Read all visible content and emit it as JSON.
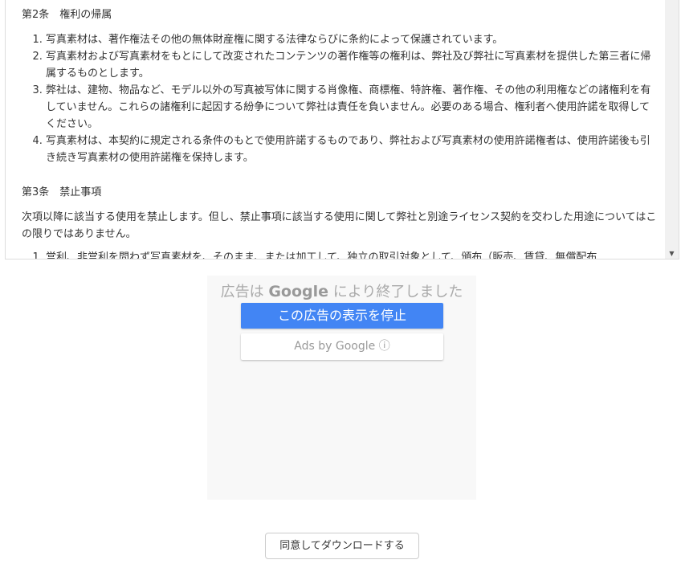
{
  "terms": {
    "article2": {
      "heading": "第2条　権利の帰属",
      "items": [
        "写真素材は、著作権法その他の無体財産権に関する法律ならびに条約によって保護されています。",
        "写真素材および写真素材をもとにして改変されたコンテンツの著作権等の権利は、弊社及び弊社に写真素材を提供した第三者に帰属するものとします。",
        "弊社は、建物、物品など、モデル以外の写真被写体に関する肖像権、商標権、特許権、著作権、その他の利用権などの諸権利を有していません。これらの諸権利に起因する紛争について弊社は責任を負いません。必要のある場合、権利者へ使用許諾を取得してください。",
        "写真素材は、本契約に規定される条件のもとで使用許諾するものであり、弊社および写真素材の使用許諾権者は、使用許諾後も引き続き写真素材の使用許諾権を保持します。"
      ]
    },
    "article3": {
      "heading": "第3条　禁止事項",
      "intro": "次項以降に該当する使用を禁止します。但し、禁止事項に該当する使用に関して弊社と別途ライセンス契約を交わした用途についてはこの限りではありません。",
      "items": [
        "営利、非営利を問わず写真素材を、そのまま、または加工して、独立の取引対象として、頒布（販売、賃貸、無償配布"
      ]
    }
  },
  "ad": {
    "title_pre": "広告は",
    "title_brand": "Google",
    "title_post": "により終了しました",
    "stop_label": "この広告の表示を停止",
    "ads_by_label": "Ads by Google ⓘ",
    "accent": "#4285f4"
  },
  "download_label": "同意してダウンロードする"
}
